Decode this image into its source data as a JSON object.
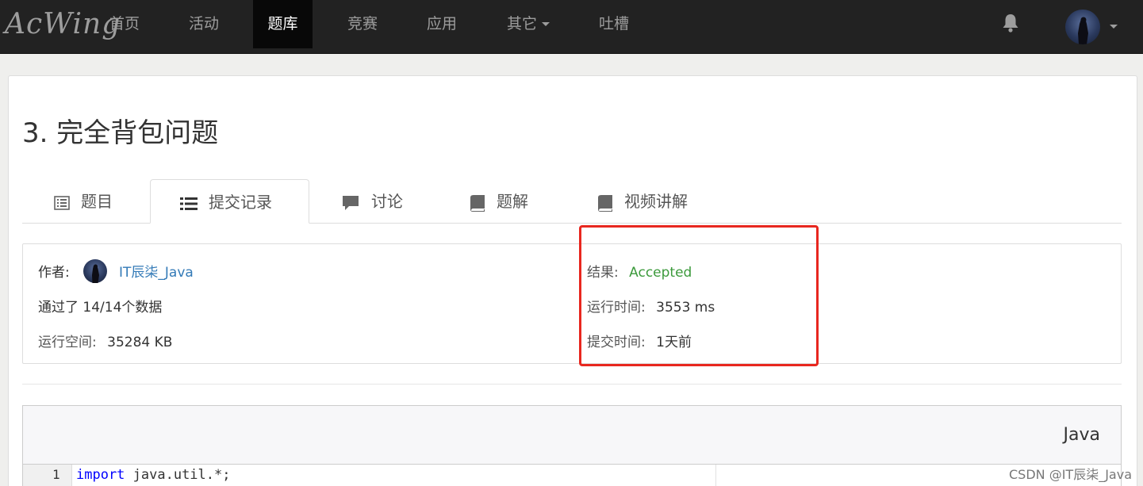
{
  "nav": {
    "logo": "AcWing",
    "items": [
      {
        "label": "首页"
      },
      {
        "label": "活动"
      },
      {
        "label": "题库"
      },
      {
        "label": "竞赛"
      },
      {
        "label": "应用"
      },
      {
        "label": "其它"
      },
      {
        "label": "吐槽"
      }
    ],
    "active": "题库"
  },
  "problem": {
    "title": "3. 完全背包问题"
  },
  "tabs": [
    {
      "label": "题目",
      "icon": "list-alt-icon"
    },
    {
      "label": "提交记录",
      "icon": "list-icon"
    },
    {
      "label": "讨论",
      "icon": "comment-icon"
    },
    {
      "label": "题解",
      "icon": "book-icon"
    },
    {
      "label": "视频讲解",
      "icon": "book-icon"
    }
  ],
  "submission": {
    "author_label": "作者:",
    "author_name": "IT辰柒_Java",
    "passed_text": "通过了 14/14个数据",
    "memory_label": "运行空间:",
    "memory_value": "35284 KB",
    "result_label": "结果:",
    "result_value": "Accepted",
    "runtime_label": "运行时间:",
    "runtime_value": "3553 ms",
    "submit_time_label": "提交时间:",
    "submit_time_value": "1天前"
  },
  "code": {
    "language": "Java",
    "line_no": "1",
    "keyword": "import",
    "rest": " java.util.*;"
  },
  "watermark": "CSDN @IT辰柒_Java",
  "colors": {
    "navbar": "#222222",
    "accepted": "#3c9a3c",
    "link": "#337ab7",
    "highlight_box": "#e8271f"
  }
}
